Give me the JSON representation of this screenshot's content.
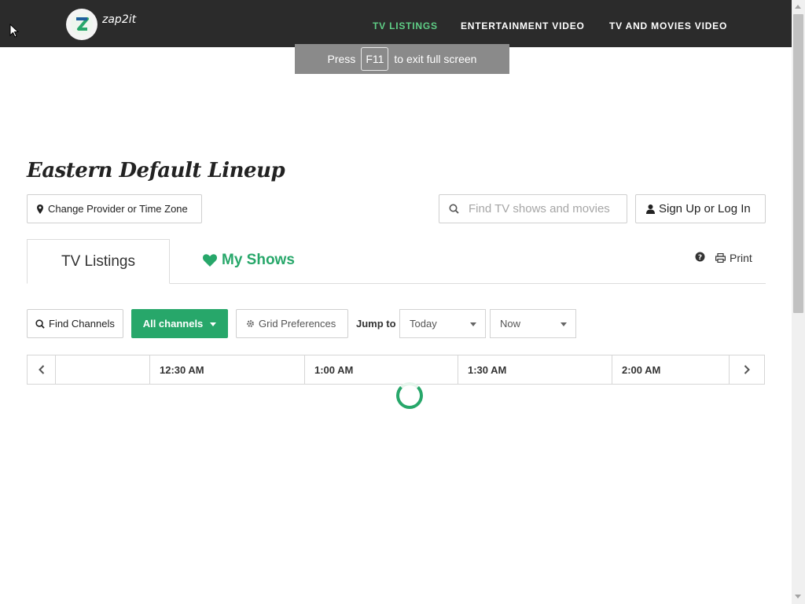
{
  "brand": {
    "name": "zap2it",
    "logo_letter": "Z"
  },
  "nav": {
    "items": [
      {
        "label": "TV LISTINGS",
        "active": true
      },
      {
        "label": "ENTERTAINMENT VIDEO",
        "active": false
      },
      {
        "label": "TV AND MOVIES VIDEO",
        "active": false
      }
    ]
  },
  "fullscreen_toast": {
    "prefix": "Press",
    "key": "F11",
    "suffix": "to exit full screen"
  },
  "lineup": {
    "title": "Eastern Default Lineup"
  },
  "buttons": {
    "change_provider": "Change Provider or Time Zone",
    "sign_in": "Sign Up or Log In",
    "find_channels": "Find Channels",
    "all_channels": "All channels",
    "grid_preferences": "Grid Preferences",
    "print": "Print"
  },
  "search": {
    "placeholder": "Find TV shows and movies"
  },
  "tabs": {
    "tv_listings": "TV Listings",
    "my_shows": "My Shows"
  },
  "jump_to": {
    "label": "Jump to",
    "day": "Today",
    "time": "Now"
  },
  "timebar": {
    "slots": [
      "12:30 AM",
      "1:00 AM",
      "1:30 AM",
      "2:00 AM"
    ]
  },
  "colors": {
    "accent": "#27a76a",
    "nav_bg": "#2b2b2b",
    "nav_active": "#5fce86"
  }
}
